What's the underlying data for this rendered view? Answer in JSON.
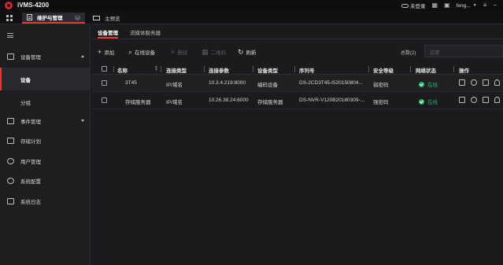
{
  "app": {
    "title": "iVMS-4200"
  },
  "titlebar": {
    "cloud_status": "未登录",
    "user": "feng..."
  },
  "tabs": [
    {
      "label": "维护与管理",
      "active": true
    },
    {
      "label": "主预览",
      "active": false
    }
  ],
  "sidebar": {
    "items": [
      {
        "label": "设备管理",
        "icon": "device-icon",
        "expanded": true
      },
      {
        "label": "设备",
        "sub": true,
        "active": true
      },
      {
        "label": "分组",
        "sub": true,
        "active": false
      },
      {
        "label": "事件管理",
        "icon": "event-icon",
        "expanded": false
      },
      {
        "label": "存储计划",
        "icon": "storage-icon"
      },
      {
        "label": "用户管理",
        "icon": "user-icon"
      },
      {
        "label": "系统配置",
        "icon": "gear-icon"
      },
      {
        "label": "系统日志",
        "icon": "log-icon"
      }
    ]
  },
  "main": {
    "subtabs": [
      {
        "label": "设备管理",
        "active": true
      },
      {
        "label": "流媒体服务器",
        "active": false
      }
    ],
    "toolbar": {
      "add": "添加",
      "online": "在线设备",
      "delete": "删除",
      "qrcode": "二维码",
      "refresh": "刷新",
      "total": "总数(2)",
      "filter_placeholder": "过滤"
    },
    "table": {
      "headers": {
        "name": "名称",
        "conn_type": "连接类型",
        "conn_param": "连接参数",
        "dev_type": "设备类型",
        "serial": "序列号",
        "security": "安全等级",
        "net_status": "网络状态",
        "ops": "操作"
      },
      "rows": [
        {
          "name": "3T45",
          "conn_type": "IP/域名",
          "conn_param": "10.3.4.219:8000",
          "dev_type": "编码设备",
          "serial": "DS-2CD3T45-I520150804...",
          "security": "弱密码",
          "net_status": "在线"
        },
        {
          "name": "存储服务器",
          "conn_type": "IP/域名",
          "conn_param": "10.26.38.24:8000",
          "dev_type": "存储服务器",
          "serial": "DS-NVR-V120B20180309-...",
          "security": "强密码",
          "net_status": "在线"
        }
      ]
    }
  },
  "colors": {
    "accent": "#e53b2f",
    "online": "#23b56c",
    "background": "#1b1b1e"
  }
}
